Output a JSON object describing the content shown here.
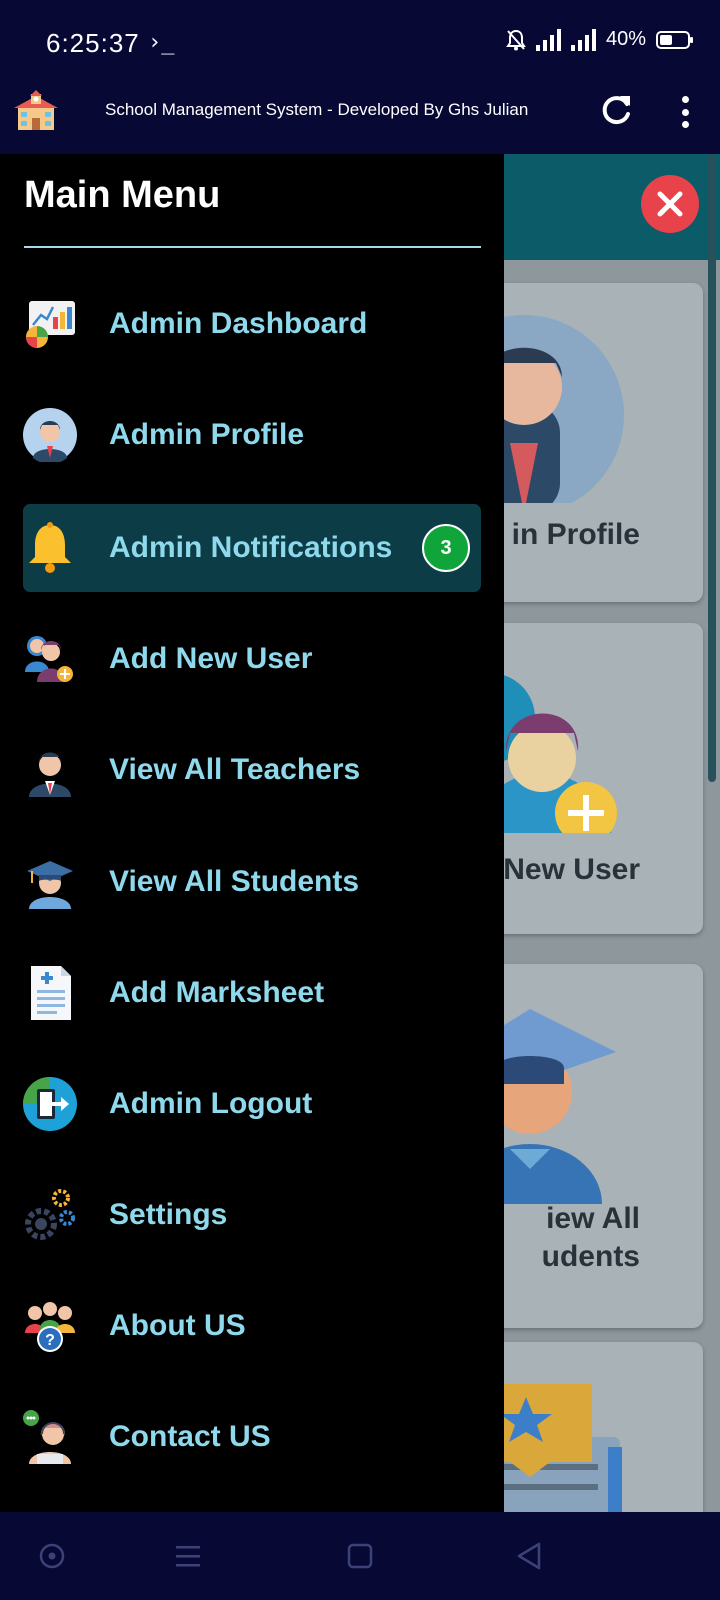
{
  "status_bar": {
    "time": "6:25:37",
    "terminal_symbol": "›_",
    "battery": "40%"
  },
  "app_bar": {
    "title": "School Management System - Developed By Ghs Julian",
    "icons": [
      "school-logo-icon",
      "refresh-icon",
      "more-vert-icon"
    ]
  },
  "drawer": {
    "title": "Main Menu",
    "items": [
      {
        "label": "Admin Dashboard",
        "icon": "dashboard-charts-icon"
      },
      {
        "label": "Admin Profile",
        "icon": "admin-avatar-icon"
      },
      {
        "label": "Admin Notifications",
        "icon": "bell-icon",
        "badge": "3",
        "active": true
      },
      {
        "label": "Add New User",
        "icon": "add-user-icon"
      },
      {
        "label": "View All Teachers",
        "icon": "teacher-icon"
      },
      {
        "label": "View All Students",
        "icon": "student-icon"
      },
      {
        "label": "Add Marksheet",
        "icon": "marksheet-icon"
      },
      {
        "label": "Admin Logout",
        "icon": "logout-icon"
      },
      {
        "label": "Settings",
        "icon": "gears-icon"
      },
      {
        "label": "About US",
        "icon": "about-group-icon"
      },
      {
        "label": "Contact US",
        "icon": "support-agent-icon"
      }
    ]
  },
  "background": {
    "cards": [
      {
        "label_lines": [
          "in Profile"
        ]
      },
      {
        "label_lines": [
          "New User"
        ]
      },
      {
        "label_lines": [
          "iew All",
          "udents"
        ]
      }
    ]
  },
  "nav_bar": {
    "icons": [
      "nav-dot-icon",
      "nav-menu-icon",
      "nav-home-icon",
      "nav-back-icon"
    ]
  },
  "colors": {
    "status_bg": "#070833",
    "drawer_bg": "#000000",
    "menu_text": "#8fd9ec",
    "active_item": "#0c3c46",
    "badge": "#0fa53a",
    "close_button": "#e8434a",
    "teal_band": "#0c5b68"
  }
}
